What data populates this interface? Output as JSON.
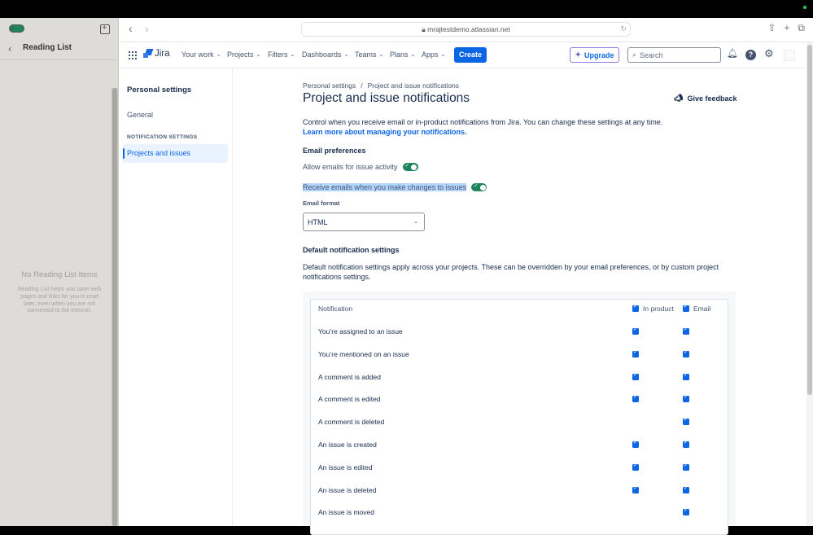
{
  "safari": {
    "sidebar": {
      "title": "Reading List",
      "empty_title": "No Reading List Items",
      "empty_description": "Reading List helps you save web pages and links for you to read later, even when you are not connected to the internet."
    },
    "url": "mrajtestdemo.atlassian.net"
  },
  "jira_nav": {
    "product": "Jira",
    "menus": [
      {
        "label": "Your work"
      },
      {
        "label": "Projects"
      },
      {
        "label": "Filters"
      },
      {
        "label": "Dashboards"
      },
      {
        "label": "Teams"
      },
      {
        "label": "Plans"
      },
      {
        "label": "Apps"
      }
    ],
    "create_label": "Create",
    "upgrade_label": "Upgrade",
    "search_placeholder": "Search"
  },
  "settings_nav": {
    "title": "Personal settings",
    "general": "General",
    "section": "NOTIFICATION SETTINGS",
    "active_item": "Projects and issues"
  },
  "main": {
    "breadcrumb": [
      "Personal settings",
      "Project and issue notifications"
    ],
    "title": "Project and issue notifications",
    "feedback_label": "Give feedback",
    "intro": "Control when you receive email or in-product notifications from Jira. You can change these settings at any time.",
    "intro_link": "Learn more about managing your notifications.",
    "email_prefs_heading": "Email preferences",
    "toggles": [
      {
        "label": "Allow emails for issue activity",
        "on": true
      },
      {
        "label": "Receive emails when you make changes to issues",
        "on": true
      }
    ],
    "email_format_label": "Email format",
    "email_format_value": "HTML",
    "default_heading": "Default notification settings",
    "default_desc": "Default notification settings apply across your projects. These can be overridden by your email preferences, or by custom project notifications settings."
  },
  "table": {
    "headers": {
      "notification": "Notification",
      "in_product": "In product",
      "email": "Email"
    },
    "rows": [
      {
        "name": "You’re assigned to an issue",
        "in_product": true,
        "email": true
      },
      {
        "name": "You’re mentioned on an issue",
        "in_product": true,
        "email": true
      },
      {
        "name": "A comment is added",
        "in_product": true,
        "email": true
      },
      {
        "name": "A comment is edited",
        "in_product": true,
        "email": true
      },
      {
        "name": "A comment is deleted",
        "in_product": false,
        "email": true
      },
      {
        "name": "An issue is created",
        "in_product": true,
        "email": true
      },
      {
        "name": "An issue is edited",
        "in_product": true,
        "email": true
      },
      {
        "name": "An issue is deleted",
        "in_product": true,
        "email": true
      },
      {
        "name": "An issue is moved",
        "in_product": false,
        "email": true
      }
    ]
  }
}
